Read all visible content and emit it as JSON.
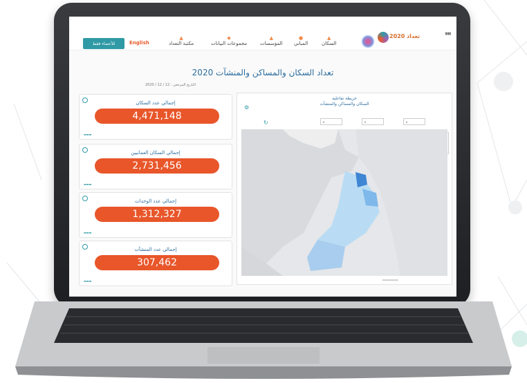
{
  "header": {
    "members_button": "للأعضاء فقط",
    "language": "English",
    "nav": [
      {
        "label": "مكتبة التعداد"
      },
      {
        "label": "مجموعات البيانات"
      },
      {
        "label": "المؤسسات"
      },
      {
        "label": "المباني"
      },
      {
        "label": "السكان"
      }
    ],
    "logo_text": "تعداد 2020"
  },
  "page": {
    "title": "تعداد السكان والمساكن والمنشآت 2020",
    "update_label": "التاريخ المرجعي : 12 / 12 / 2020"
  },
  "cards": [
    {
      "label": "إجمالي عدد السكان",
      "value": "4,471,148"
    },
    {
      "label": "إجمالي السكان العمانيين",
      "value": "2,731,456"
    },
    {
      "label": "إجمالي عدد الوحدات",
      "value": "1,312,327"
    },
    {
      "label": "إجمالي عدد المنشآت",
      "value": "307,462"
    }
  ],
  "map": {
    "title_line1": "خريطة تفاعلية",
    "title_line2": "السكان والمساكن والمنشآت"
  },
  "colors": {
    "accent": "#e8562a",
    "teal": "#2f9aa5",
    "title_blue": "#2b6d9e"
  }
}
